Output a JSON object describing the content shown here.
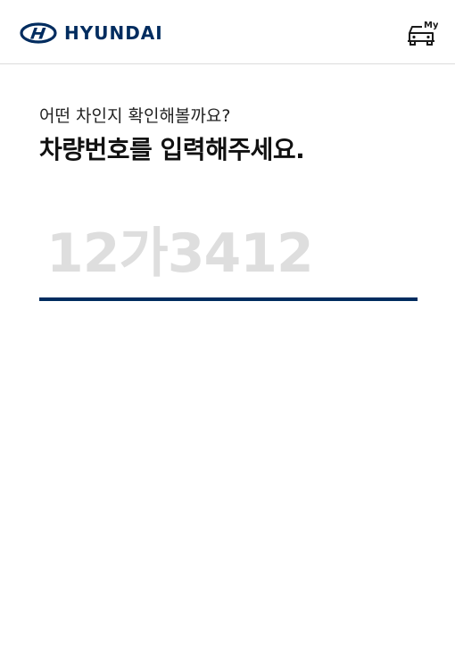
{
  "header": {
    "brand": "HYUNDAI",
    "my_car_label": "My",
    "logo_icon": "hyundai-logo-icon",
    "my_car_icon": "my-car-icon"
  },
  "main": {
    "subtitle": "어떤 차인지 확인해볼까요?",
    "title": "차량번호를 입력해주세요.",
    "plate_input": {
      "value": "",
      "placeholder": "12가3412"
    }
  },
  "colors": {
    "brand_navy": "#002c5f",
    "placeholder": "#dedede",
    "divider": "#dcdcdc"
  }
}
